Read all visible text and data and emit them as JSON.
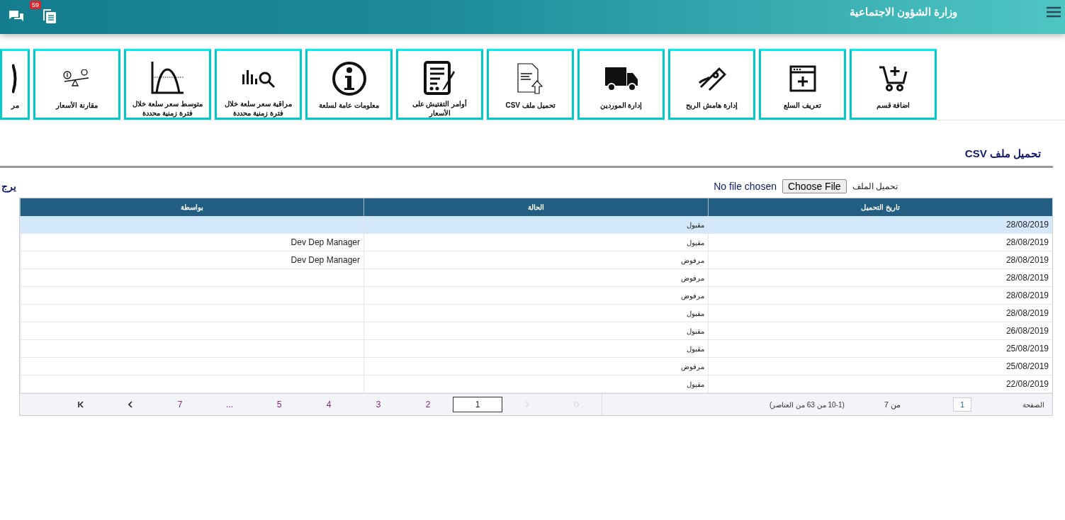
{
  "header": {
    "title": "وزارة الشؤون الاجتماعية",
    "badge": "59"
  },
  "tiles": [
    {
      "label": "اضافة قسم"
    },
    {
      "label": "تعريف السلع"
    },
    {
      "label": "إدارة هامش الربح"
    },
    {
      "label": "إدارة الموردين"
    },
    {
      "label": "تحميل ملف CSV"
    },
    {
      "label": "أوامر التفتيش على الأسعار"
    },
    {
      "label": "معلومات عامة لسلعة"
    },
    {
      "label": "مراقبة سعر سلعة خلال فترة زمنية محددة"
    },
    {
      "label": "متوسط سعر سلعة خلال فترة زمنية محددة"
    },
    {
      "label": "مقارنة الأسعار"
    },
    {
      "label": "مر"
    }
  ],
  "section_title": "تحميل ملف CSV",
  "upload": {
    "label": "تحميل الملف",
    "button": "Choose File",
    "status": "No file chosen"
  },
  "notice": "يرج",
  "table": {
    "columns": [
      "تاريخ التحميل",
      "الحالة",
      "بواسطة"
    ],
    "rows": [
      {
        "cells": [
          "28/08/2019",
          "مقبول",
          ""
        ],
        "selected": true
      },
      {
        "cells": [
          "28/08/2019",
          "مقبول",
          "Dev Dep Manager"
        ],
        "selected": false
      },
      {
        "cells": [
          "28/08/2019",
          "مرفوض",
          "Dev Dep Manager"
        ],
        "selected": false
      },
      {
        "cells": [
          "28/08/2019",
          "مرفوض",
          ""
        ],
        "selected": false
      },
      {
        "cells": [
          "28/08/2019",
          "مرفوض",
          ""
        ],
        "selected": false
      },
      {
        "cells": [
          "28/08/2019",
          "مقبول",
          ""
        ],
        "selected": false
      },
      {
        "cells": [
          "26/08/2019",
          "مقبول",
          ""
        ],
        "selected": false
      },
      {
        "cells": [
          "25/08/2019",
          "مقبول",
          ""
        ],
        "selected": false
      },
      {
        "cells": [
          "25/08/2019",
          "مرفوض",
          ""
        ],
        "selected": false
      },
      {
        "cells": [
          "22/08/2019",
          "مقبول",
          ""
        ],
        "selected": false
      }
    ]
  },
  "pager": {
    "page_label": "الصفحة",
    "page_value": "1",
    "of_total": "من 7",
    "summary": "(10-1 من 63 من العناصر)",
    "items": [
      {
        "kind": "first",
        "disabled": true
      },
      {
        "kind": "prev",
        "disabled": true
      },
      {
        "kind": "page",
        "label": "1",
        "selected": true
      },
      {
        "kind": "page",
        "label": "2",
        "selected": false
      },
      {
        "kind": "page",
        "label": "3",
        "selected": false
      },
      {
        "kind": "page",
        "label": "4",
        "selected": false
      },
      {
        "kind": "page",
        "label": "5",
        "selected": false
      },
      {
        "kind": "page",
        "label": "...",
        "selected": false
      },
      {
        "kind": "page",
        "label": "7",
        "selected": false
      },
      {
        "kind": "next",
        "disabled": false
      },
      {
        "kind": "last",
        "disabled": false
      }
    ]
  }
}
